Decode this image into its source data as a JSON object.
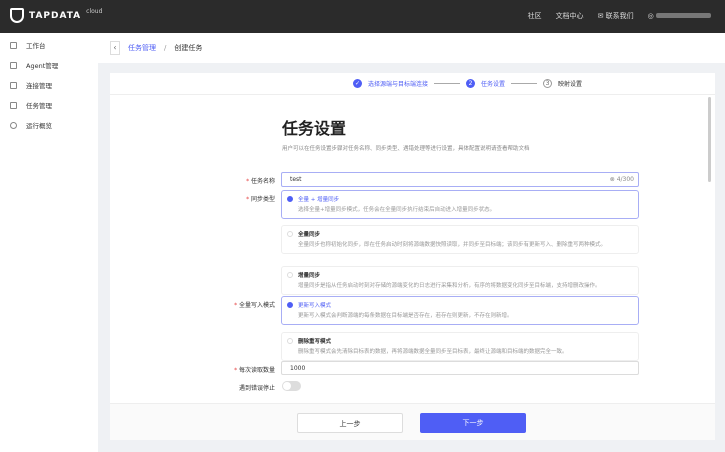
{
  "header": {
    "brand": "TAPDATA",
    "brand_sub": "cloud",
    "nav": [
      "社区",
      "文档中心",
      "联系我们"
    ]
  },
  "sidebar": {
    "items": [
      {
        "label": "工作台",
        "icon": "monitor-icon"
      },
      {
        "label": "Agent管理",
        "icon": "agent-icon"
      },
      {
        "label": "连接管理",
        "icon": "connection-icon"
      },
      {
        "label": "任务管理",
        "icon": "task-icon"
      },
      {
        "label": "运行概览",
        "icon": "clock-icon"
      }
    ]
  },
  "breadcrumb": {
    "parent": "任务管理",
    "sep": "/",
    "current": "创建任务"
  },
  "steps": [
    {
      "num": "✓",
      "label": "选择源端与目标端连接"
    },
    {
      "num": "2",
      "label": "任务设置"
    },
    {
      "num": "3",
      "label": "映射设置"
    }
  ],
  "form": {
    "title": "任务设置",
    "intro": "用户可以在任务设置步骤对任务名称、同步类型、遇错处理等进行设置，具体配置说明请查看帮助文档",
    "name_label": "任务名称",
    "name_value": "test",
    "name_count": "4/300",
    "sync_label": "同步类型",
    "sync_options": [
      {
        "title": "全量 + 增量同步",
        "desc": "选择全量+增量同步模式，任务会在全量同步执行结束后自动进入增量同步状态。",
        "selected": true
      },
      {
        "title": "全量同步",
        "desc": "全量同步也称初始化同步，即在任务启动时刻将源端数据快照读取，并同步至目标端；该同步有更新写入、删除重写两种模式。",
        "selected": false
      },
      {
        "title": "增量同步",
        "desc": "增量同步是指从任务启动时刻对存储的源端变化的日志进行采集和分析，有序的将数据变化同步至目标端，支持增删改操作。",
        "selected": false
      }
    ],
    "write_label": "全量写入模式",
    "write_options": [
      {
        "title": "更新写入模式",
        "desc": "更新写入模式会判断源端的每条数据在目标端是否存在，若存在则更新，不存在则新增。",
        "selected": true
      },
      {
        "title": "删除重写模式",
        "desc": "删除重写模式会先清除目标表的数据，再将源端数据全量同步至目标表，最终让源端和目标端的数据完全一致。",
        "selected": false
      }
    ],
    "read_label": "每次读取数量",
    "read_value": "1000",
    "stop_label": "遇到错误停止",
    "stop_on": false
  },
  "footer": {
    "prev": "上一步",
    "next": "下一步"
  },
  "colors": {
    "accent": "#4f5ef5",
    "topbar": "#2b2b2b"
  }
}
